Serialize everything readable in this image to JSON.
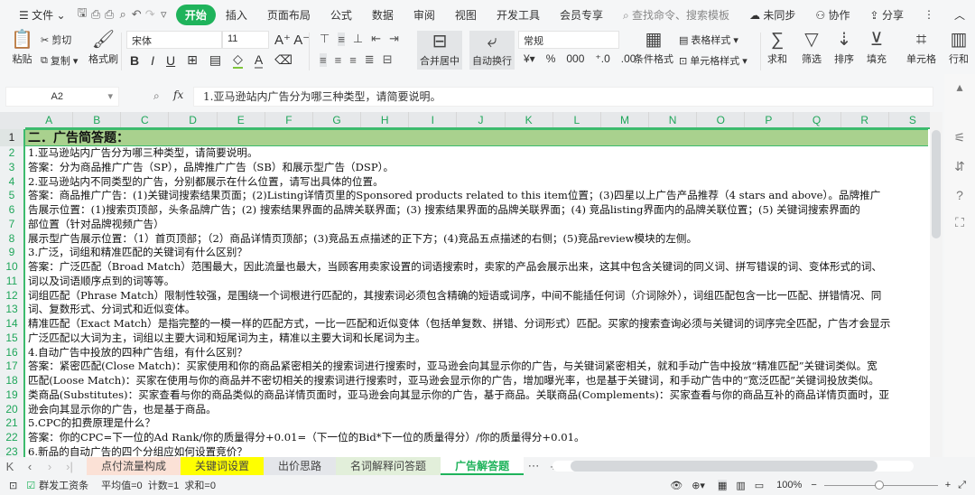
{
  "menu": {
    "file": "文件",
    "items": [
      "开始",
      "插入",
      "页面布局",
      "公式",
      "数据",
      "审阅",
      "视图",
      "开发工具",
      "会员专享"
    ],
    "search_placeholder": "查找命令、搜索模板",
    "sync": "未同步",
    "collab": "协作",
    "share": "分享"
  },
  "ribbon": {
    "paste": "粘贴",
    "cut": "剪切",
    "copy": "复制",
    "format_painter": "格式刷",
    "font": "宋体",
    "size": "11",
    "merge": "合并居中",
    "wrap": "自动换行",
    "number_format": "常规",
    "cond_format": "条件格式",
    "table_style": "表格样式",
    "cell_style": "单元格样式",
    "sum": "求和",
    "filter": "筛选",
    "sort": "排序",
    "fill": "填充",
    "cell": "单元格",
    "rowcol": "行和"
  },
  "formula_bar": {
    "name_box": "A2",
    "fx": "fx",
    "content": "1.亚马逊站内广告分为哪三种类型，请简要说明。"
  },
  "columns": [
    "A",
    "B",
    "C",
    "D",
    "E",
    "F",
    "G",
    "H",
    "I",
    "J",
    "K",
    "L",
    "M",
    "N",
    "O",
    "P",
    "Q",
    "R",
    "S"
  ],
  "rows": [
    {
      "n": "1",
      "text": "二．广告简答题："
    },
    {
      "n": "2",
      "text": "1.亚马逊站内广告分为哪三种类型，请简要说明。"
    },
    {
      "n": "3",
      "text": "答案：分为商品推广广告（SP），品牌推广广告（SB）和展示型广告（DSP）。"
    },
    {
      "n": "4",
      "text": "2.亚马逊站内不同类型的广告，分别都展示在什么位置，请写出具体的位置。"
    },
    {
      "n": "5",
      "text": "答案：商品推广广告：(1)关键词搜索结果页面；(2)Listing详情页里的Sponsored products related to this item位置；(3)四星以上广告产品推荐（4 stars and above）。品牌推广"
    },
    {
      "n": "6",
      "text": "告展示位置：(1)搜索页顶部，头条品牌广告；(2) 搜索结果界面的品牌关联界面；(3) 搜索结果界面的品牌关联界面；(4) 竞品listing界面内的品牌关联位置；(5) 关键词搜索界面的"
    },
    {
      "n": "7",
      "text": "部位置（针对品牌视频广告）"
    },
    {
      "n": "8",
      "text": "展示型广告展示位置：（1）首页顶部；（2）商品详情页顶部；(3)竞品五点描述的正下方；(4)竞品五点描述的右侧；(5)竞品review模块的左侧。"
    },
    {
      "n": "9",
      "text": "3.广泛，词组和精准匹配的关键词有什么区别？"
    },
    {
      "n": "10",
      "text": "答案：广泛匹配（Broad Match）范围最大，因此流量也最大，当顾客用卖家设置的词语搜索时，卖家的产品会展示出来，这其中包含关键词的同义词、拼写错误的词、变体形式的词、"
    },
    {
      "n": "11",
      "text": "词以及词语顺序点到的词等等。"
    },
    {
      "n": "12",
      "text": "词组匹配（Phrase Match）限制性较强，是围绕一个词根进行匹配的，其搜索词必须包含精确的短语或词序，中间不能插任何词（介词除外），词组匹配包含一比一匹配、拼错情况、同"
    },
    {
      "n": "13",
      "text": "词、复数形式、分词式和近似变体。"
    },
    {
      "n": "14",
      "text": "精准匹配（Exact Match）是指完整的一模一样的匹配方式，一比一匹配和近似变体（包括单复数、拼错、分词形式）匹配。买家的搜索查询必须与关键词的词序完全匹配，广告才会显示"
    },
    {
      "n": "15",
      "text": "广泛匹配以大词为主，词组以主要大词和短尾词为主，精准以主要大词和长尾词为主。"
    },
    {
      "n": "16",
      "text": "4.自动广告中投放的四种广告组，有什么区别？"
    },
    {
      "n": "17",
      "text": "答案：紧密匹配(Close Match)：买家使用和你的商品紧密相关的搜索词进行搜索时，亚马逊会向其显示你的广告，与关键词紧密相关，就和手动广告中投放“精准匹配”关键词类似。宽"
    },
    {
      "n": "18",
      "text": "匹配(Loose Match)：买家在使用与你的商品并不密切相关的搜索词进行搜索时，亚马逊会显示你的广告，增加曝光率，也是基于关键词，和手动广告中的“宽泛匹配”关键词投放类似。"
    },
    {
      "n": "19",
      "text": "类商品(Substitutes)：买家查看与你的商品类似的商品详情页面时，亚马逊会向其显示你的广告，基于商品。关联商品(Complements)：买家查看与你的商品互补的商品详情页面时，亚"
    },
    {
      "n": "20",
      "text": "逊会向其显示你的广告，也是基于商品。"
    },
    {
      "n": "21",
      "text": "5.CPC的扣费原理是什么？"
    },
    {
      "n": "22",
      "text": "答案：你的CPC=下一位的Ad Rank/你的质量得分+0.01=（下一位的Bid*下一位的质量得分）/你的质量得分+0.01。"
    },
    {
      "n": "23",
      "text": "6.新品的自动广告的四个分组应如何设置竞价？"
    }
  ],
  "sheet_tabs": [
    {
      "label": "点付流量构成",
      "bg": "#fbe1d6"
    },
    {
      "label": "关键词设置",
      "bg": "#ffff00"
    },
    {
      "label": "出价思路",
      "bg": "#e4e6ea"
    },
    {
      "label": "名词解释问答题",
      "bg": "#e2efda"
    },
    {
      "label": "广告解答题",
      "bg": "#ffffff"
    }
  ],
  "status": {
    "macro": "群发工资条",
    "stats": "平均值=0  计数=1  求和=0",
    "zoom": "100%"
  },
  "colors": {
    "accent": "#1fb35b",
    "header_fill": "#a9d18e"
  }
}
